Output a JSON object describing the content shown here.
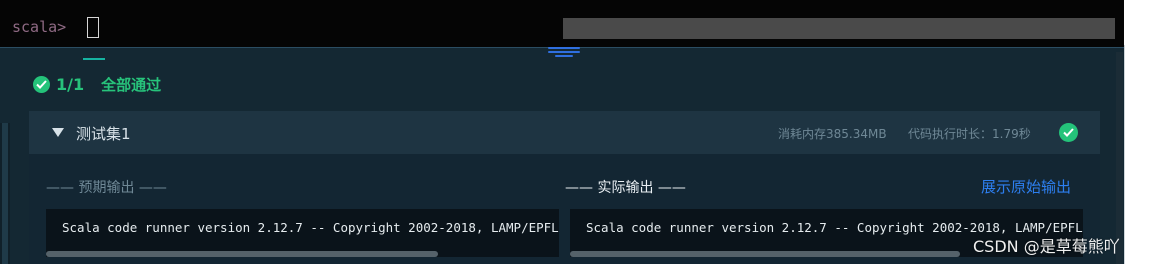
{
  "terminal": {
    "prompt": "scala>"
  },
  "results": {
    "summary": {
      "count": "1/1",
      "status": "全部通过"
    },
    "suite": {
      "title": "测试集1",
      "memory": "消耗内存385.34MB",
      "time": "代码执行时长：1.79秒"
    },
    "expected_label": "—— 预期输出 ——",
    "actual_label": "—— 实际输出 ——",
    "show_raw_button": "展示原始输出",
    "expected_output": "Scala code runner version 2.12.7 -- Copyright 2002-2018, LAMP/EPFL",
    "actual_output": "Scala code runner version 2.12.7 -- Copyright 2002-2018, LAMP/EPFL"
  },
  "watermark": "CSDN @是草莓熊吖",
  "colors": {
    "success": "#24c37a",
    "link": "#2d7ff0",
    "terminal_bg": "#050505",
    "panel_bg": "#142833"
  },
  "icons": [
    "check-circle-icon",
    "caret-down-icon",
    "splitter-handle-icon"
  ]
}
